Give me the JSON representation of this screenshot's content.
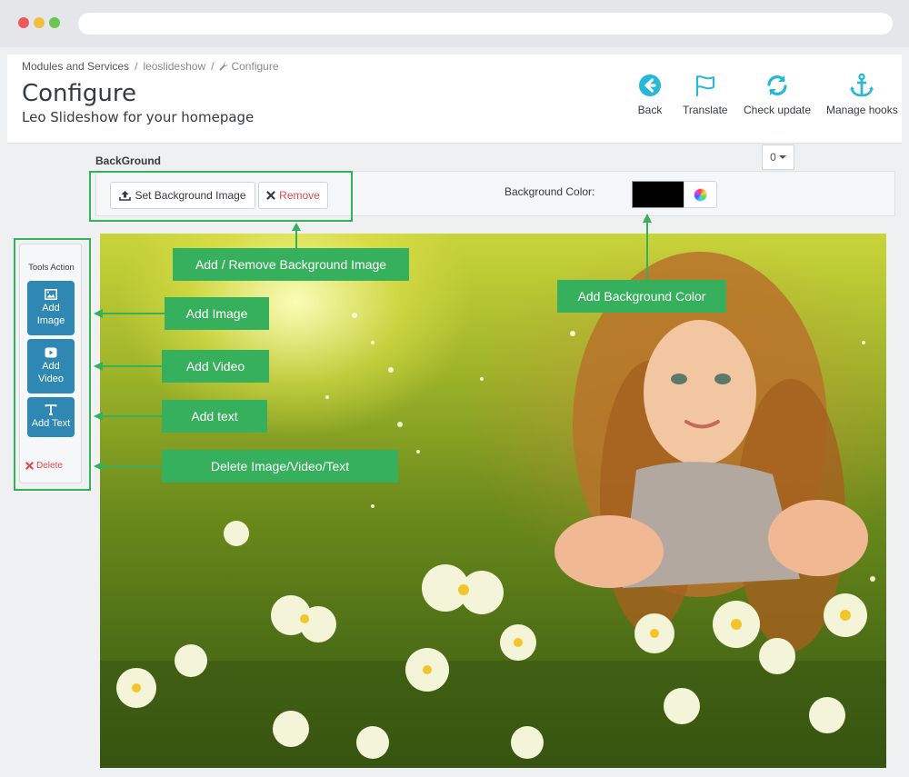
{
  "breadcrumb": {
    "items": [
      "Modules and Services",
      "leoslideshow",
      "Configure"
    ],
    "separator": "/"
  },
  "header": {
    "title": "Configure",
    "subtitle": "Leo Slideshow for your homepage"
  },
  "toolbar": [
    {
      "label": "Back",
      "icon": "back-arrow-circle-icon"
    },
    {
      "label": "Translate",
      "icon": "flag-icon"
    },
    {
      "label": "Check update",
      "icon": "refresh-icon"
    },
    {
      "label": "Manage hooks",
      "icon": "anchor-icon"
    }
  ],
  "background": {
    "title": "BackGround",
    "dropdown_value": "0",
    "set_image_label": "Set Background Image",
    "remove_label": "Remove",
    "color_label": "Background Color:",
    "color_value": "#000000"
  },
  "tools": {
    "title": "Tools Action",
    "add_image": [
      "Add",
      "Image"
    ],
    "add_video": [
      "Add",
      "Video"
    ],
    "add_text": "Add Text",
    "delete": "Delete"
  },
  "callouts": {
    "bg_image": "Add / Remove Background Image",
    "bg_color": "Add Background Color",
    "add_image": "Add Image",
    "add_video": "Add Video",
    "add_text": "Add text",
    "delete": "Delete Image/Video/Text"
  },
  "colors": {
    "accent_green": "#36b05c",
    "tool_blue": "#2e88b3",
    "toolbar_blue": "#25b9d7",
    "danger_red": "#e34a4a"
  }
}
